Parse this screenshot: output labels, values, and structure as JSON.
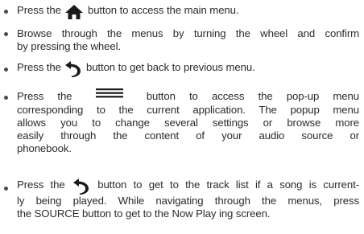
{
  "instructions": {
    "item1": {
      "before": "Press the",
      "icon": "home-icon",
      "after": "button to access the main menu."
    },
    "item2": {
      "line1": "Browse through the menus by turning the wheel and confirm",
      "line2": "by pressing the wheel."
    },
    "item3": {
      "before": "Press the",
      "icon": "back-icon",
      "after": "button to get back to previous menu."
    },
    "item4": {
      "before": "Press the",
      "icon": "menu-icon",
      "after": "button to access the pop-up menu",
      "line2": "corresponding to the current application. The popup menu",
      "line3": "allows you to change several settings or browse more",
      "line4": "easily through the content of your audio source or",
      "line5": "phonebook."
    },
    "item5": {
      "before": "Press the",
      "icon": "back-icon",
      "after": "button to get to the track list if a song is current-",
      "line2": "ly being played. While navigating through the menus, press",
      "line3": "the SOURCE button to get to the Now Play ing screen."
    }
  },
  "colors": {
    "text": "#2b2b2b",
    "icon": "#1a1a1a"
  }
}
